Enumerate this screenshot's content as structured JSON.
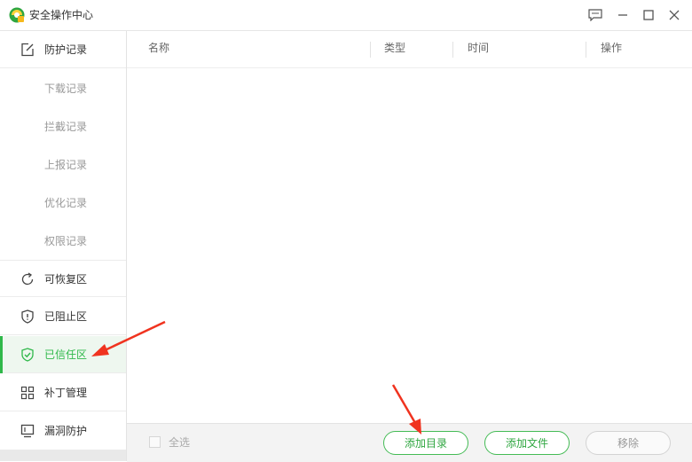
{
  "window": {
    "title": "安全操作中心",
    "icons": [
      "feedback-icon",
      "minimize-icon",
      "maximize-icon",
      "close-icon"
    ]
  },
  "sidebar": {
    "items": [
      {
        "label": "防护记录",
        "icon": "edit-record-icon"
      },
      {
        "label": "下载记录"
      },
      {
        "label": "拦截记录"
      },
      {
        "label": "上报记录"
      },
      {
        "label": "优化记录"
      },
      {
        "label": "权限记录"
      },
      {
        "label": "可恢复区",
        "icon": "restore-icon"
      },
      {
        "label": "已阻止区",
        "icon": "shield-alert-icon"
      },
      {
        "label": "已信任区",
        "icon": "shield-check-icon",
        "active": true
      },
      {
        "label": "补丁管理",
        "icon": "patch-grid-icon"
      },
      {
        "label": "漏洞防护",
        "icon": "monitor-icon"
      }
    ]
  },
  "table": {
    "columns": [
      "名称",
      "类型",
      "时间",
      "操作"
    ],
    "rows": []
  },
  "footer": {
    "select_all_label": "全选",
    "add_dir_label": "添加目录",
    "add_file_label": "添加文件",
    "remove_label": "移除"
  },
  "colors": {
    "accent": "#2fb84a",
    "arrow": "#f0331f"
  }
}
